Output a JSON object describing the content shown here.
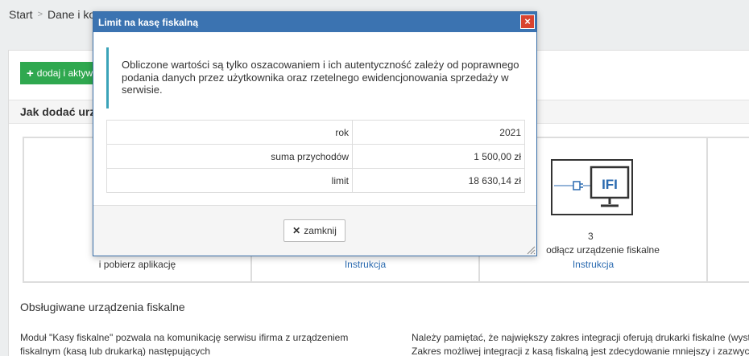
{
  "breadcrumb": {
    "items": [
      "Start",
      "Dane i ko"
    ]
  },
  "page": {
    "add_button_label": "dodaj i aktyw",
    "section_title": "Jak dodać urzą",
    "steps": [
      {
        "text": "i pobierz aplikację"
      },
      {
        "link": "Instrukcja"
      },
      {
        "number": "3",
        "text": "odłącz urządzenie fiskalne",
        "link": "Instrukcja",
        "icon_label": "IFI"
      }
    ],
    "fiscal_title": "Obsługiwane urządzenia fiskalne",
    "para_left": "Moduł \"Kasy fiskalne\" pozwala na komunikację serwisu ifirma z urządzeniem fiskalnym (kasą lub drukarką) następujących",
    "para_right_1": "Należy pamiętać, że największy zakres integracji oferują drukarki fiskalne (wyst",
    "para_right_2": "Zakres możliwej integracji z kasą fiskalną jest zdecydowanie mniejszy i zazwyc"
  },
  "modal": {
    "title": "Limit na kasę fiskalną",
    "info": "Obliczone wartości są tylko oszacowaniem i ich autentyczność zależy od poprawnego podania danych przez użytkownika oraz rzetelnego ewidencjonowania sprzedaży w serwisie.",
    "rows": [
      {
        "label": "rok",
        "value": "2021"
      },
      {
        "label": "suma przychodów",
        "value": "1 500,00 zł"
      },
      {
        "label": "limit",
        "value": "18 630,14 zł"
      }
    ],
    "close_label": "zamknij"
  }
}
